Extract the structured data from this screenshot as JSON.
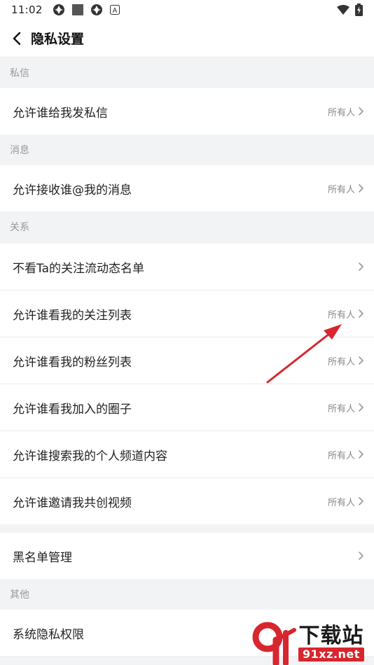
{
  "status_bar": {
    "time": "11:02",
    "badge_letter": "A"
  },
  "header": {
    "title": "隐私设置"
  },
  "sections": [
    {
      "title": "私信",
      "rows": [
        {
          "label": "允许谁给我发私信",
          "value": "所有人"
        }
      ]
    },
    {
      "title": "消息",
      "rows": [
        {
          "label": "允许接收谁@我的消息",
          "value": "所有人"
        }
      ]
    },
    {
      "title": "关系",
      "rows": [
        {
          "label": "不看Ta的关注流动态名单",
          "value": ""
        },
        {
          "label": "允许谁看我的关注列表",
          "value": "所有人"
        },
        {
          "label": "允许谁看我的粉丝列表",
          "value": "所有人"
        },
        {
          "label": "允许谁看我加入的圈子",
          "value": "所有人"
        },
        {
          "label": "允许谁搜索我的个人频道内容",
          "value": "所有人"
        },
        {
          "label": "允许谁邀请我共创视频",
          "value": "所有人"
        }
      ]
    },
    {
      "title": "",
      "rows": [
        {
          "label": "黑名单管理",
          "value": ""
        }
      ]
    },
    {
      "title": "其他",
      "rows": [
        {
          "label": "系统隐私权限",
          "value": ""
        }
      ]
    }
  ],
  "watermark": {
    "mark": "9f",
    "text": "下载站",
    "url": "91xz.net"
  },
  "colors": {
    "accent_red": "#d8262e",
    "annotation_arrow": "#d8262e"
  }
}
